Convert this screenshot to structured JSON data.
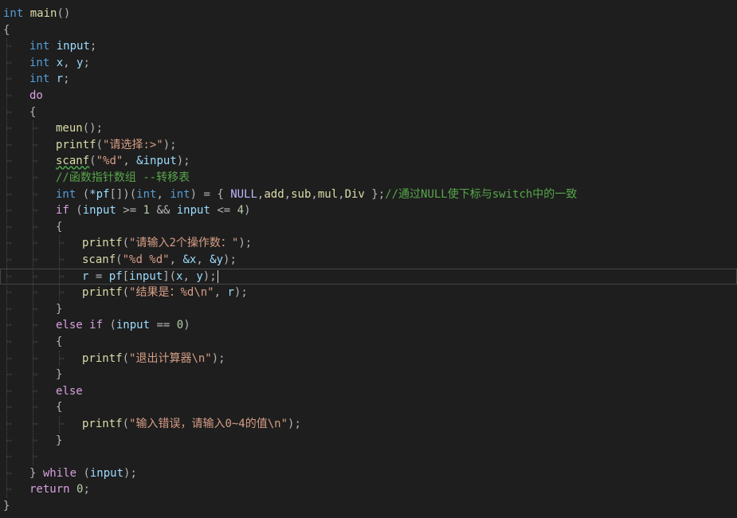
{
  "editor": {
    "lines": [
      {
        "indent": 0,
        "tokens": [
          {
            "t": "int",
            "c": "kw"
          },
          {
            "t": " ",
            "c": ""
          },
          {
            "t": "main",
            "c": "fn"
          },
          {
            "t": "()",
            "c": "pun"
          }
        ]
      },
      {
        "indent": 0,
        "tokens": [
          {
            "t": "{",
            "c": "pun"
          }
        ]
      },
      {
        "indent": 1,
        "tokens": [
          {
            "t": "int",
            "c": "kw"
          },
          {
            "t": " ",
            "c": ""
          },
          {
            "t": "input",
            "c": "var"
          },
          {
            "t": ";",
            "c": "pun"
          }
        ]
      },
      {
        "indent": 1,
        "tokens": [
          {
            "t": "int",
            "c": "kw"
          },
          {
            "t": " ",
            "c": ""
          },
          {
            "t": "x",
            "c": "var"
          },
          {
            "t": ", ",
            "c": "pun"
          },
          {
            "t": "y",
            "c": "var"
          },
          {
            "t": ";",
            "c": "pun"
          }
        ]
      },
      {
        "indent": 1,
        "tokens": [
          {
            "t": "int",
            "c": "kw"
          },
          {
            "t": " ",
            "c": ""
          },
          {
            "t": "r",
            "c": "var"
          },
          {
            "t": ";",
            "c": "pun"
          }
        ]
      },
      {
        "indent": 1,
        "tokens": [
          {
            "t": "do",
            "c": "kw2"
          }
        ]
      },
      {
        "indent": 1,
        "tokens": [
          {
            "t": "{",
            "c": "pun"
          }
        ]
      },
      {
        "indent": 2,
        "tokens": [
          {
            "t": "meun",
            "c": "fn"
          },
          {
            "t": "();",
            "c": "pun"
          }
        ]
      },
      {
        "indent": 2,
        "tokens": [
          {
            "t": "printf",
            "c": "fn"
          },
          {
            "t": "(",
            "c": "pun"
          },
          {
            "t": "\"请选择:>\"",
            "c": "str"
          },
          {
            "t": ");",
            "c": "pun"
          }
        ]
      },
      {
        "indent": 2,
        "tokens": [
          {
            "t": "scanf",
            "c": "fn",
            "sq": true
          },
          {
            "t": "(",
            "c": "pun"
          },
          {
            "t": "\"%d\"",
            "c": "str"
          },
          {
            "t": ", ",
            "c": "pun"
          },
          {
            "t": "&input",
            "c": "var"
          },
          {
            "t": ");",
            "c": "pun"
          }
        ]
      },
      {
        "indent": 2,
        "tokens": [
          {
            "t": "//函数指针数组 --转移表",
            "c": "cmt"
          }
        ]
      },
      {
        "indent": 2,
        "tokens": [
          {
            "t": "int",
            "c": "kw"
          },
          {
            "t": " (",
            "c": "pun"
          },
          {
            "t": "*pf",
            "c": "var"
          },
          {
            "t": "[])(",
            "c": "pun"
          },
          {
            "t": "int",
            "c": "kw"
          },
          {
            "t": ", ",
            "c": "pun"
          },
          {
            "t": "int",
            "c": "kw"
          },
          {
            "t": ") = { ",
            "c": "pun"
          },
          {
            "t": "NULL",
            "c": "mac"
          },
          {
            "t": ",",
            "c": "pun"
          },
          {
            "t": "add",
            "c": "fn"
          },
          {
            "t": ",",
            "c": "pun"
          },
          {
            "t": "sub",
            "c": "fn"
          },
          {
            "t": ",",
            "c": "pun"
          },
          {
            "t": "mul",
            "c": "fn"
          },
          {
            "t": ",",
            "c": "pun"
          },
          {
            "t": "Div",
            "c": "fn"
          },
          {
            "t": " };",
            "c": "pun"
          },
          {
            "t": "//通过NULL使下标与switch中的一致",
            "c": "cmt"
          }
        ]
      },
      {
        "indent": 2,
        "tokens": [
          {
            "t": "if",
            "c": "kw2"
          },
          {
            "t": " (",
            "c": "pun"
          },
          {
            "t": "input",
            "c": "var"
          },
          {
            "t": " >= ",
            "c": "pun"
          },
          {
            "t": "1",
            "c": "num"
          },
          {
            "t": " && ",
            "c": "pun"
          },
          {
            "t": "input",
            "c": "var"
          },
          {
            "t": " <= ",
            "c": "pun"
          },
          {
            "t": "4",
            "c": "num"
          },
          {
            "t": ")",
            "c": "pun"
          }
        ]
      },
      {
        "indent": 2,
        "tokens": [
          {
            "t": "{",
            "c": "pun"
          }
        ]
      },
      {
        "indent": 3,
        "tokens": [
          {
            "t": "printf",
            "c": "fn"
          },
          {
            "t": "(",
            "c": "pun"
          },
          {
            "t": "\"请输入2个操作数：\"",
            "c": "str"
          },
          {
            "t": ");",
            "c": "pun"
          }
        ]
      },
      {
        "indent": 3,
        "tokens": [
          {
            "t": "scanf",
            "c": "fn"
          },
          {
            "t": "(",
            "c": "pun"
          },
          {
            "t": "\"%d %d\"",
            "c": "str"
          },
          {
            "t": ", ",
            "c": "pun"
          },
          {
            "t": "&x",
            "c": "var"
          },
          {
            "t": ", ",
            "c": "pun"
          },
          {
            "t": "&y",
            "c": "var"
          },
          {
            "t": ");",
            "c": "pun"
          }
        ]
      },
      {
        "indent": 3,
        "current": true,
        "tokens": [
          {
            "t": "r",
            "c": "var"
          },
          {
            "t": " = ",
            "c": "pun"
          },
          {
            "t": "pf",
            "c": "var"
          },
          {
            "t": "[",
            "c": "pun"
          },
          {
            "t": "input",
            "c": "var"
          },
          {
            "t": "](",
            "c": "pun"
          },
          {
            "t": "x",
            "c": "var"
          },
          {
            "t": ", ",
            "c": "pun"
          },
          {
            "t": "y",
            "c": "var"
          },
          {
            "t": ");",
            "c": "pun"
          }
        ]
      },
      {
        "indent": 3,
        "tokens": [
          {
            "t": "printf",
            "c": "fn"
          },
          {
            "t": "(",
            "c": "pun"
          },
          {
            "t": "\"结果是：%d\\n\"",
            "c": "str"
          },
          {
            "t": ", ",
            "c": "pun"
          },
          {
            "t": "r",
            "c": "var"
          },
          {
            "t": ");",
            "c": "pun"
          }
        ]
      },
      {
        "indent": 2,
        "tokens": [
          {
            "t": "}",
            "c": "pun"
          }
        ]
      },
      {
        "indent": 2,
        "tokens": [
          {
            "t": "else",
            "c": "kw2"
          },
          {
            "t": " ",
            "c": ""
          },
          {
            "t": "if",
            "c": "kw2"
          },
          {
            "t": " (",
            "c": "pun"
          },
          {
            "t": "input",
            "c": "var"
          },
          {
            "t": " == ",
            "c": "pun"
          },
          {
            "t": "0",
            "c": "num"
          },
          {
            "t": ")",
            "c": "pun"
          }
        ]
      },
      {
        "indent": 2,
        "tokens": [
          {
            "t": "{",
            "c": "pun"
          }
        ]
      },
      {
        "indent": 3,
        "tokens": [
          {
            "t": "printf",
            "c": "fn"
          },
          {
            "t": "(",
            "c": "pun"
          },
          {
            "t": "\"退出计算器\\n\"",
            "c": "str"
          },
          {
            "t": ");",
            "c": "pun"
          }
        ]
      },
      {
        "indent": 2,
        "tokens": [
          {
            "t": "}",
            "c": "pun"
          }
        ]
      },
      {
        "indent": 2,
        "tokens": [
          {
            "t": "else",
            "c": "kw2"
          }
        ]
      },
      {
        "indent": 2,
        "tokens": [
          {
            "t": "{",
            "c": "pun"
          }
        ]
      },
      {
        "indent": 3,
        "tokens": [
          {
            "t": "printf",
            "c": "fn"
          },
          {
            "t": "(",
            "c": "pun"
          },
          {
            "t": "\"输入错误，请输入0~4的值\\n\"",
            "c": "str"
          },
          {
            "t": ");",
            "c": "pun"
          }
        ]
      },
      {
        "indent": 2,
        "tokens": [
          {
            "t": "}",
            "c": "pun"
          }
        ]
      },
      {
        "indent": 2,
        "tokens": []
      },
      {
        "indent": 1,
        "tokens": [
          {
            "t": "} ",
            "c": "pun"
          },
          {
            "t": "while",
            "c": "kw2"
          },
          {
            "t": " (",
            "c": "pun"
          },
          {
            "t": "input",
            "c": "var"
          },
          {
            "t": ");",
            "c": "pun"
          }
        ]
      },
      {
        "indent": 1,
        "tokens": [
          {
            "t": "return",
            "c": "kw2"
          },
          {
            "t": " ",
            "c": ""
          },
          {
            "t": "0",
            "c": "num"
          },
          {
            "t": ";",
            "c": "pun"
          }
        ]
      },
      {
        "indent": 0,
        "tokens": [
          {
            "t": "}",
            "c": "pun"
          }
        ]
      }
    ]
  }
}
